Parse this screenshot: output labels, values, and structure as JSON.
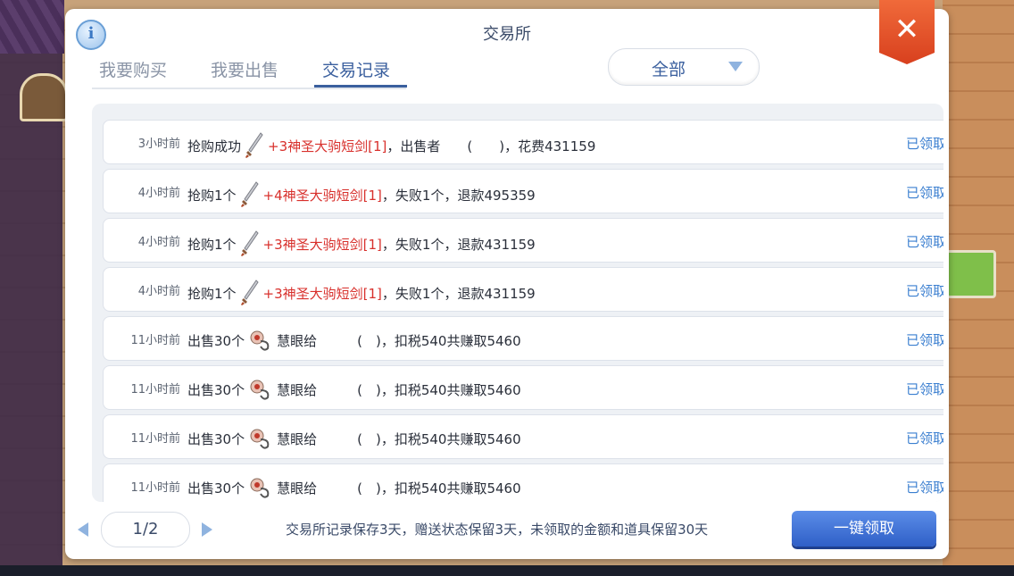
{
  "window": {
    "title": "交易所"
  },
  "tabs": [
    {
      "label": "我要购买",
      "active": false
    },
    {
      "label": "我要出售",
      "active": false
    },
    {
      "label": "交易记录",
      "active": true
    }
  ],
  "filter": {
    "selected": "全部"
  },
  "records": [
    {
      "time": "3小时前",
      "pre": "抢购成功",
      "icon": "dagger-icon",
      "item": "+3神圣大驹短剑[1]",
      "post": "，出售者　　(　　)，花费431159",
      "status": "已领取"
    },
    {
      "time": "4小时前",
      "pre": "抢购1个",
      "icon": "dagger-icon",
      "item": "+4神圣大驹短剑[1]",
      "post": "，失败1个，退款495359",
      "status": "已领取"
    },
    {
      "time": "4小时前",
      "pre": "抢购1个",
      "icon": "dagger-icon",
      "item": "+3神圣大驹短剑[1]",
      "post": "，失败1个，退款431159",
      "status": "已领取"
    },
    {
      "time": "4小时前",
      "pre": "抢购1个",
      "icon": "dagger-icon",
      "item": "+3神圣大驹短剑[1]",
      "post": "，失败1个，退款431159",
      "status": "已领取"
    },
    {
      "time": "11小时前",
      "pre": "出售30个",
      "icon": "pendant-icon",
      "item": "慧眼给",
      "post": "　　　(　)，扣税540共赚取5460",
      "status": "已领取"
    },
    {
      "time": "11小时前",
      "pre": "出售30个",
      "icon": "pendant-icon",
      "item": "慧眼给",
      "post": "　　　(　)，扣税540共赚取5460",
      "status": "已领取"
    },
    {
      "time": "11小时前",
      "pre": "出售30个",
      "icon": "pendant-icon",
      "item": "慧眼给",
      "post": "　　　(　)，扣税540共赚取5460",
      "status": "已领取"
    },
    {
      "time": "11小时前",
      "pre": "出售30个",
      "icon": "pendant-icon",
      "item": "慧眼给",
      "post": "　　　(　)，扣税540共赚取5460",
      "status": "已领取"
    }
  ],
  "pager": {
    "text": "1/2"
  },
  "footer": {
    "note": "交易所记录保存3天，赠送状态保留3天，未领取的金额和道具保留30天",
    "claim_all_label": "一键领取"
  },
  "colors": {
    "accent": "#3a5f9e",
    "claimed": "#3b7fd0",
    "item_red": "#d8302c",
    "close_red": "#e0502a",
    "button_blue": "#2f5fc7"
  }
}
